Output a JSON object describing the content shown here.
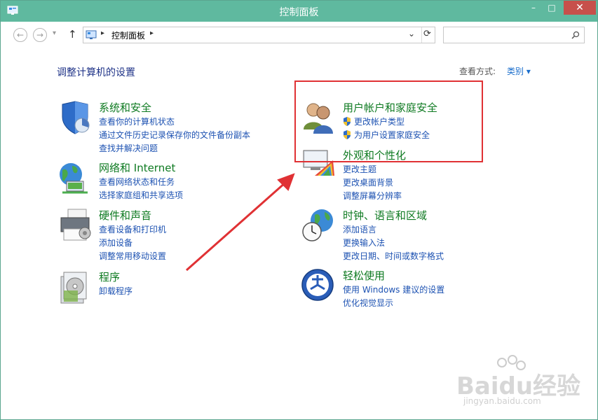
{
  "window": {
    "title": "控制面板"
  },
  "window_controls": {
    "minimize": "–",
    "maximize": "□",
    "close": "✕"
  },
  "nav": {
    "back": "←",
    "forward": "→",
    "up": "↑",
    "dropdown": "▾"
  },
  "address": {
    "path": "控制面板"
  },
  "search": {
    "placeholder": ""
  },
  "page": {
    "heading": "调整计算机的设置",
    "view_by_label": "查看方式:",
    "view_by_value": "类别"
  },
  "categories": [
    {
      "name": "系统和安全",
      "icon": "shield-icon",
      "links": [
        "查看你的计算机状态",
        "通过文件历史记录保存你的文件备份副本",
        "查找并解决问题"
      ]
    },
    {
      "name": "网络和 Internet",
      "icon": "network-globe-icon",
      "links": [
        "查看网络状态和任务",
        "选择家庭组和共享选项"
      ]
    },
    {
      "name": "硬件和声音",
      "icon": "printer-icon",
      "links": [
        "查看设备和打印机",
        "添加设备",
        "调整常用移动设置"
      ]
    },
    {
      "name": "程序",
      "icon": "programs-icon",
      "links": [
        "卸载程序"
      ]
    },
    {
      "name": "用户帐户和家庭安全",
      "icon": "users-icon",
      "links": [
        "更改帐户类型",
        "为用户设置家庭安全"
      ]
    },
    {
      "name": "外观和个性化",
      "icon": "display-palette-icon",
      "links": [
        "更改主题",
        "更改桌面背景",
        "调整屏幕分辨率"
      ]
    },
    {
      "name": "时钟、语言和区域",
      "icon": "clock-globe-icon",
      "links": [
        "添加语言",
        "更换输入法",
        "更改日期、时间或数字格式"
      ]
    },
    {
      "name": "轻松使用",
      "icon": "ease-of-access-icon",
      "links": [
        "使用 Windows 建议的设置",
        "优化视觉显示"
      ]
    }
  ],
  "watermark": {
    "brand": "Baidu经验",
    "url": "jingyan.baidu.com"
  },
  "colors": {
    "titlebar": "#5fb99f",
    "category_title": "#0e7a21",
    "link": "#1d52b2",
    "highlight": "#e03134"
  }
}
